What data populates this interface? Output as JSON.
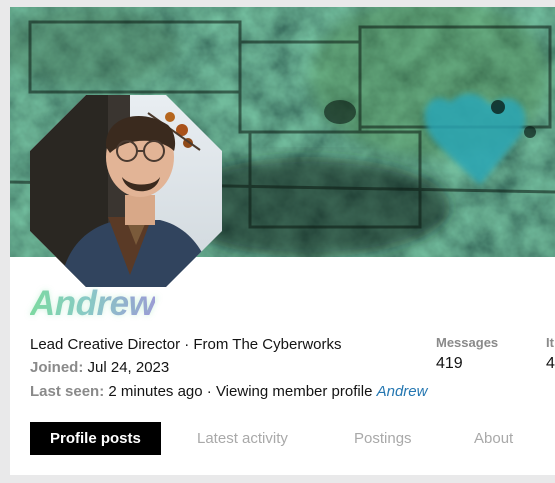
{
  "profile": {
    "username": "Andrew",
    "byline": "Lead Creative Director · From The Cyberworks",
    "joined_label": "Joined:",
    "joined_value": "Jul 24, 2023",
    "last_seen_label": "Last seen:",
    "last_seen_value": "2 minutes ago",
    "separator": "·",
    "activity_text": "Viewing member profile",
    "activity_link": "Andrew",
    "username_gradient": [
      "#7ed8a2",
      "#8ec7cf",
      "#a28fe0"
    ]
  },
  "stats": [
    {
      "label": "Messages",
      "value": "419"
    },
    {
      "label": "It",
      "value": "4"
    }
  ],
  "tabs": [
    {
      "label": "Profile posts",
      "active": true
    },
    {
      "label": "Latest activity",
      "active": false
    },
    {
      "label": "Postings",
      "active": false
    },
    {
      "label": "About",
      "active": false
    }
  ],
  "colors": {
    "page_background": "#e9e9ea",
    "card_background": "#ffffff",
    "link": "#2577b1",
    "muted_label": "#8a8a8a",
    "active_tab_bg": "#000000"
  }
}
